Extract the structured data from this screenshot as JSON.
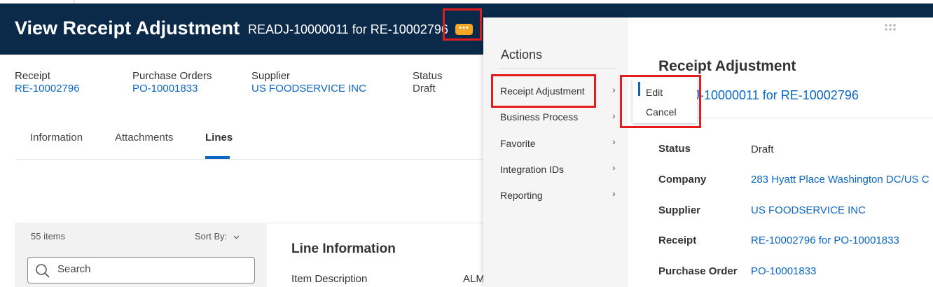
{
  "header": {
    "title": "View Receipt Adjustment",
    "subtitle": "READJ-10000011 for RE-10002796",
    "more_button": "•••"
  },
  "meta": {
    "receipt": {
      "label": "Receipt",
      "value": "RE-10002796"
    },
    "purchase_orders": {
      "label": "Purchase Orders",
      "value": "PO-10001833"
    },
    "supplier": {
      "label": "Supplier",
      "value": "US FOODSERVICE INC"
    },
    "status": {
      "label": "Status",
      "value": "Draft"
    }
  },
  "tabs": [
    {
      "label": "Information"
    },
    {
      "label": "Attachments"
    },
    {
      "label": "Lines",
      "active": true
    }
  ],
  "list": {
    "count": "55 items",
    "sort_by": "Sort By:",
    "search_placeholder": "Search"
  },
  "detail": {
    "heading": "Line Information",
    "item_description_label": "Item Description",
    "item_description_value": "ALM"
  },
  "actions": {
    "title": "Actions",
    "items": [
      {
        "label": "Receipt Adjustment"
      },
      {
        "label": "Business Process"
      },
      {
        "label": "Favorite"
      },
      {
        "label": "Integration IDs"
      },
      {
        "label": "Reporting"
      }
    ]
  },
  "submenu": {
    "items": [
      {
        "label": "Edit"
      },
      {
        "label": "Cancel"
      }
    ]
  },
  "related": {
    "title": "Receipt Adjustment",
    "subtitle": "READJ-10000011 for RE-10002796",
    "rows": [
      {
        "label": "Status",
        "value": "Draft"
      },
      {
        "label": "Company",
        "value": "283 Hyatt Place Washington DC/US C"
      },
      {
        "label": "Supplier",
        "value": "US FOODSERVICE INC"
      },
      {
        "label": "Receipt",
        "value": "RE-10002796 for PO-10001833"
      },
      {
        "label": "Purchase Order",
        "value": "PO-10001833"
      }
    ]
  },
  "colors": {
    "header_bg": "#0b2a4a",
    "link": "#0b66c2",
    "more_button": "#f5a623",
    "highlight_box": "#e51c1c"
  }
}
